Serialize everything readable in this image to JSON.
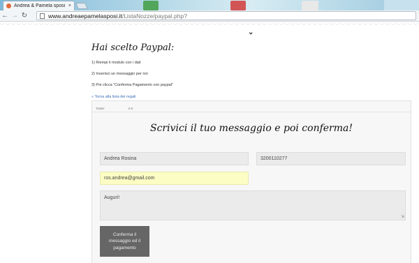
{
  "browser": {
    "tab_title": "Andrea & Pamela sposi",
    "tab_close": "×",
    "url_host": "www.andreaepamelasposi.it",
    "url_path": "/ListaNozze/paypal.php?"
  },
  "page": {
    "chevron": "⌄",
    "heading": "Hai scelto Paypal:",
    "steps": [
      "1) Riempi il modulo con i dati",
      "2) Inserisci un messaggio per noi",
      "3) Poi clicca \"Conferma Pagamento con paypal\""
    ],
    "back_link": "« Torna alla lista dei regali"
  },
  "form": {
    "meta_left": "Totale:",
    "meta_right": "€ €",
    "title": "Scrivici il tuo messaggio e poi conferma!",
    "name_value": "Andrea Rosina",
    "phone_value": "3200110277",
    "email_value": "ros.andrea@gmail.com",
    "message_value": "Auguri!",
    "submit_label": "Conferma il messaggio ed il pagamento"
  },
  "colors": {
    "accent_link": "#3b6fb6",
    "button_bg": "#666666",
    "autofill_bg": "#fcfdc4"
  }
}
